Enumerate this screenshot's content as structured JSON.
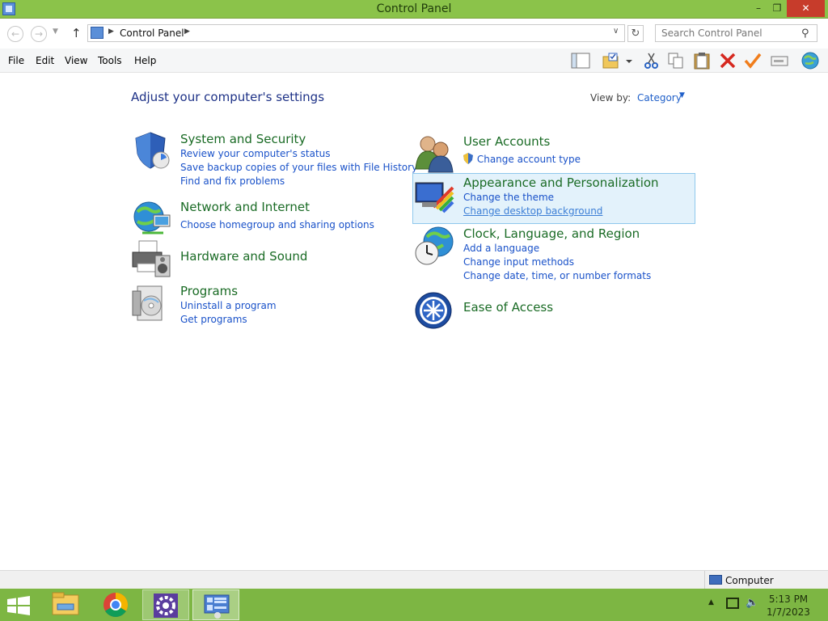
{
  "window": {
    "title": "Control Panel",
    "min": "–",
    "max": "❐",
    "close": "✕"
  },
  "address": {
    "path": "Control Panel",
    "search_placeholder": "Search Control Panel"
  },
  "menu": [
    "File",
    "Edit",
    "View",
    "Tools",
    "Help"
  ],
  "content": {
    "heading": "Adjust your computer's settings",
    "view_by_label": "View by:",
    "view_by_value": "Category"
  },
  "categories": {
    "system": {
      "title": "System and Security",
      "links": [
        "Review your computer's status",
        "Save backup copies of your files with File History",
        "Find and fix problems"
      ]
    },
    "network": {
      "title": "Network and Internet",
      "links": [
        "Choose homegroup and sharing options"
      ]
    },
    "hardware": {
      "title": "Hardware and Sound"
    },
    "programs": {
      "title": "Programs",
      "links": [
        "Uninstall a program",
        "Get programs"
      ]
    },
    "users": {
      "title": "User Accounts",
      "links": [
        "Change account type"
      ]
    },
    "appearance": {
      "title": "Appearance and Personalization",
      "links": [
        "Change the theme",
        "Change desktop background"
      ]
    },
    "clock": {
      "title": "Clock, Language, and Region",
      "links": [
        "Add a language",
        "Change input methods",
        "Change date, time, or number formats"
      ]
    },
    "ease": {
      "title": "Ease of Access"
    }
  },
  "status": {
    "location": "Computer"
  },
  "taskbar": {
    "time": "5:13 PM",
    "date": "1/7/2023"
  },
  "colors": {
    "titlebar": "#8bc34a",
    "taskbar": "#7db643",
    "category_title": "#1a6b25",
    "link": "#1a52c9",
    "heading": "#1e3287"
  }
}
